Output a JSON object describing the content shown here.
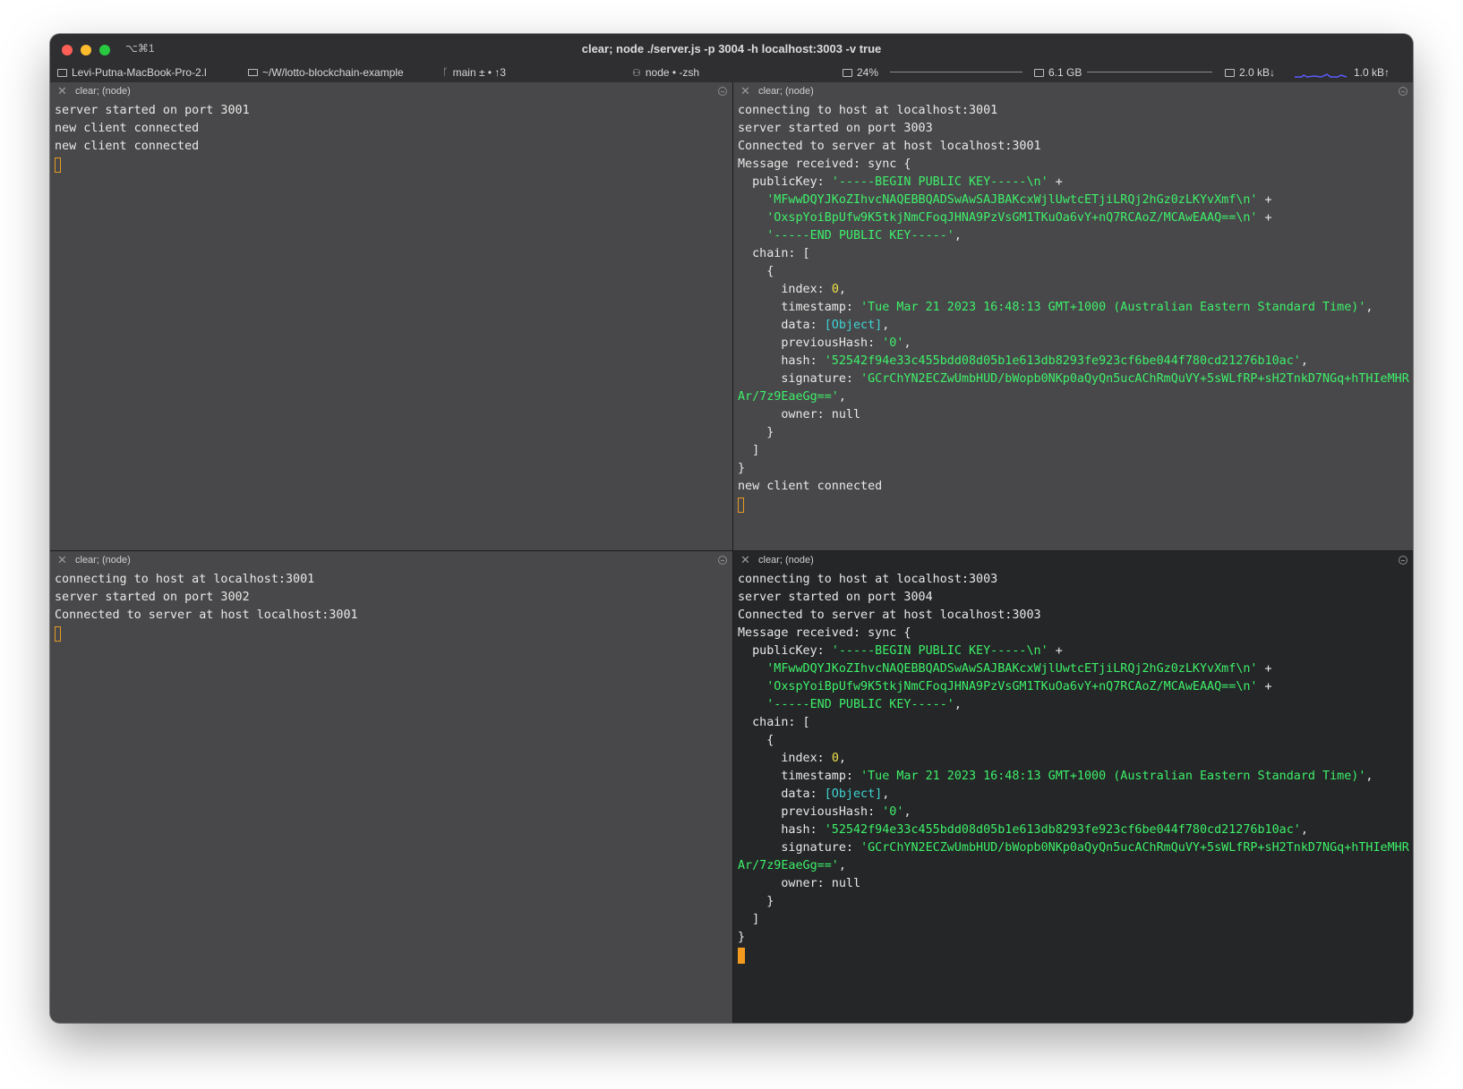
{
  "window": {
    "title": "clear; node ./server.js -p 3004 -h localhost:3003 -v true",
    "shortcut": "⌥⌘1"
  },
  "statusbar": {
    "host": "Levi-Putna-MacBook-Pro-2.l",
    "path": "~/W/lotto-blockchain-example",
    "git": "main ± • ↑3",
    "process": "node • -zsh",
    "cpu": "24%",
    "memory": "6.1 GB",
    "net_down": "2.0 kB↓",
    "net_up": "1.0 kB↑",
    "cpu_level_percent": 24
  },
  "panes": {
    "top_left": {
      "title": "clear; (node)",
      "lines": [
        "server started on port 3001",
        "new client connected",
        "new client connected"
      ]
    },
    "top_right": {
      "title": "clear; (node)",
      "intro": [
        "connecting to host at localhost:3001",
        "server started on port 3003",
        "Connected to server at host localhost:3001"
      ],
      "outro": "new client connected"
    },
    "bottom_left": {
      "title": "clear; (node)",
      "lines": [
        "connecting to host at localhost:3001",
        "server started on port 3002",
        "Connected to server at host localhost:3001"
      ]
    },
    "bottom_right": {
      "title": "clear; (node)",
      "intro": [
        "connecting to host at localhost:3003",
        "server started on port 3004",
        "Connected to server at host localhost:3003"
      ]
    }
  },
  "message": {
    "header": "Message received: sync {",
    "public_key_label": "  publicKey: ",
    "pk1": "'-----BEGIN PUBLIC KEY-----\\n'",
    "pk2": "'MFwwDQYJKoZIhvcNAQEBBQADSwAwSAJBAKcxWjlUwtcETjiLRQj2hGz0zLKYvXmf\\n'",
    "pk3": "'OxspYoiBpUfw9K5tkjNmCFoqJHNA9PzVsGM1TKuOa6vY+nQ7RCAoZ/MCAwEAAQ==\\n'",
    "pk4": "'-----END PUBLIC KEY-----'",
    "plus": " +",
    "comma": ",",
    "chain_open": "  chain: [",
    "block_open": "    {",
    "index_label": "      index: ",
    "index_value": "0",
    "timestamp_label": "      timestamp: ",
    "timestamp_value": "'Tue Mar 21 2023 16:48:13 GMT+1000 (Australian Eastern Standard Time)'",
    "data_label": "      data: ",
    "data_value": "[Object]",
    "prev_label": "      previousHash: ",
    "prev_value": "'0'",
    "hash_label": "      hash: ",
    "hash_value": "'52542f94e33c455bdd08d05b1e613db8293fe923cf6be044f780cd21276b10ac'",
    "sig_label": "      signature: ",
    "sig_value_1": "'GCrChYN2ECZwUmbHUD/bWopb0NKp0aQyQn5ucAChRmQuVY+5sWLfRP+sH2TnkD7NGq+hTHIeMHR",
    "sig_value_2": "Ar/7z9EaeGg=='",
    "owner_line": "      owner: null",
    "block_close": "    }",
    "chain_close": "  ]",
    "close": "}"
  }
}
